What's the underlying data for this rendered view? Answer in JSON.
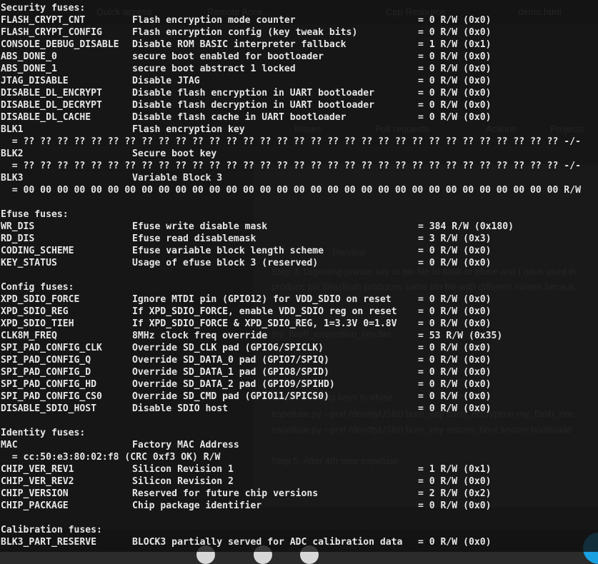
{
  "terminal": {
    "sections": [
      {
        "header": "Security fuses:",
        "rows": [
          {
            "name": "FLASH_CRYPT_CNT",
            "desc": "Flash encryption mode counter",
            "value": "= 0 R/W (0x0)"
          },
          {
            "name": "FLASH_CRYPT_CONFIG",
            "desc": "Flash encryption config (key tweak bits)",
            "value": "= 0 R/W (0x0)"
          },
          {
            "name": "CONSOLE_DEBUG_DISABLE",
            "desc": "Disable ROM BASIC interpreter fallback",
            "value": "= 1 R/W (0x1)"
          },
          {
            "name": "ABS_DONE_0",
            "desc": "secure boot enabled for bootloader",
            "value": "= 0 R/W (0x0)"
          },
          {
            "name": "ABS_DONE_1",
            "desc": "secure boot abstract 1 locked",
            "value": "= 0 R/W (0x0)"
          },
          {
            "name": "JTAG_DISABLE",
            "desc": "Disable JTAG",
            "value": "= 0 R/W (0x0)"
          },
          {
            "name": "DISABLE_DL_ENCRYPT",
            "desc": "Disable flash encryption in UART bootloader",
            "value": "= 0 R/W (0x0)"
          },
          {
            "name": "DISABLE_DL_DECRYPT",
            "desc": "Disable flash decryption in UART bootloader",
            "value": "= 0 R/W (0x0)"
          },
          {
            "name": "DISABLE_DL_CACHE",
            "desc": "Disable flash cache in UART bootloader",
            "value": "= 0 R/W (0x0)"
          },
          {
            "name": "BLK1",
            "desc": "Flash encryption key",
            "value": ""
          },
          {
            "full": "  = ?? ?? ?? ?? ?? ?? ?? ?? ?? ?? ?? ?? ?? ?? ?? ?? ?? ?? ?? ?? ?? ?? ?? ?? ?? ?? ?? ?? ?? ?? ?? ?? -/-"
          },
          {
            "name": "BLK2",
            "desc": "Secure boot key",
            "value": ""
          },
          {
            "full": "  = ?? ?? ?? ?? ?? ?? ?? ?? ?? ?? ?? ?? ?? ?? ?? ?? ?? ?? ?? ?? ?? ?? ?? ?? ?? ?? ?? ?? ?? ?? ?? ?? -/-"
          },
          {
            "name": "BLK3",
            "desc": "Variable Block 3",
            "value": ""
          },
          {
            "full": "  = 00 00 00 00 00 00 00 00 00 00 00 00 00 00 00 00 00 00 00 00 00 00 00 00 00 00 00 00 00 00 00 00 R/W"
          }
        ]
      },
      {
        "header": "Efuse fuses:",
        "rows": [
          {
            "name": "WR_DIS",
            "desc": "Efuse write disable mask",
            "value": "= 384 R/W (0x180)"
          },
          {
            "name": "RD_DIS",
            "desc": "Efuse read disablemask",
            "value": "= 3 R/W (0x3)"
          },
          {
            "name": "CODING_SCHEME",
            "desc": "Efuse variable block length scheme",
            "value": "= 0 R/W (0x0)"
          },
          {
            "name": "KEY_STATUS",
            "desc": "Usage of efuse block 3 (reserved)",
            "value": "= 0 R/W (0x0)"
          }
        ]
      },
      {
        "header": "Config fuses:",
        "rows": [
          {
            "name": "XPD_SDIO_FORCE",
            "desc": "Ignore MTDI pin (GPIO12) for VDD_SDIO on reset",
            "value": "= 0 R/W (0x0)"
          },
          {
            "name": "XPD_SDIO_REG",
            "desc": "If XPD_SDIO_FORCE, enable VDD_SDIO reg on reset",
            "value": "= 0 R/W (0x0)"
          },
          {
            "name": "XPD_SDIO_TIEH",
            "desc": "If XPD_SDIO_FORCE & XPD_SDIO_REG, 1=3.3V 0=1.8V",
            "value": "= 0 R/W (0x0)"
          },
          {
            "name": "CLK8M_FREQ",
            "desc": "8MHz clock freq override",
            "value": "= 53 R/W (0x35)"
          },
          {
            "name": "SPI_PAD_CONFIG_CLK",
            "desc": "Override SD_CLK pad (GPIO6/SPICLK)",
            "value": "= 0 R/W (0x0)"
          },
          {
            "name": "SPI_PAD_CONFIG_Q",
            "desc": "Override SD_DATA_0 pad (GPIO7/SPIQ)",
            "value": "= 0 R/W (0x0)"
          },
          {
            "name": "SPI_PAD_CONFIG_D",
            "desc": "Override SD_DATA_1 pad (GPIO8/SPID)",
            "value": "= 0 R/W (0x0)"
          },
          {
            "name": "SPI_PAD_CONFIG_HD",
            "desc": "Override SD_DATA_2 pad (GPIO9/SPIHD)",
            "value": "= 0 R/W (0x0)"
          },
          {
            "name": "SPI_PAD_CONFIG_CS0",
            "desc": "Override SD_CMD pad (GPIO11/SPICS0)",
            "value": "= 0 R/W (0x0)"
          },
          {
            "name": "DISABLE_SDIO_HOST",
            "desc": "Disable SDIO host",
            "value": "= 0 R/W (0x0)"
          }
        ]
      },
      {
        "header": "Identity fuses:",
        "rows": [
          {
            "name": "MAC",
            "desc": "Factory MAC Address",
            "value": ""
          },
          {
            "full": "  = cc:50:e3:80:02:f8 (CRC 0xf3 OK) R/W"
          },
          {
            "name": "CHIP_VER_REV1",
            "desc": "Silicon Revision 1",
            "value": "= 1 R/W (0x1)"
          },
          {
            "name": "CHIP_VER_REV2",
            "desc": "Silicon Revision 2",
            "value": "= 0 R/W (0x0)"
          },
          {
            "name": "CHIP_VERSION",
            "desc": "Reserved for future chip versions",
            "value": "= 2 R/W (0x2)"
          },
          {
            "name": "CHIP_PACKAGE",
            "desc": "Chip package identifier",
            "value": "= 0 R/W (0x0)"
          }
        ]
      },
      {
        "header": "Calibration fuses:",
        "rows": [
          {
            "name": "BLK3_PART_RESERVE",
            "desc": "BLOCK3 partially served for ADC calibration data",
            "value": "= 0 R/W (0x0)"
          }
        ]
      }
    ]
  },
  "background_page": {
    "tab_labels": [
      "Quick access",
      "Remote Acce...",
      "Cpp Resource",
      "demo.html"
    ],
    "repo_nav": [
      "Issues",
      "Pull requests",
      "Actions",
      "Projects"
    ],
    "editor_tab": "Preview",
    "body_lines": [
      "Step 3: Digesting private key to bin file to flash to efuse and I have used th",
      "produce bin files(Both produces same bin file with different names becaus",
      "my_flash_encryption_key.bin",
      "Step 4: Burning keys to efuse",
      "espefuse.py --port /dev/ttyUSB0 burn_key flash_encryption my_flash_enc",
      "espefuse.py --port /dev/ttyUSB0 burn_key secure_boot secure-bootloade",
      "Step 5: After 4th step espefuse"
    ]
  }
}
